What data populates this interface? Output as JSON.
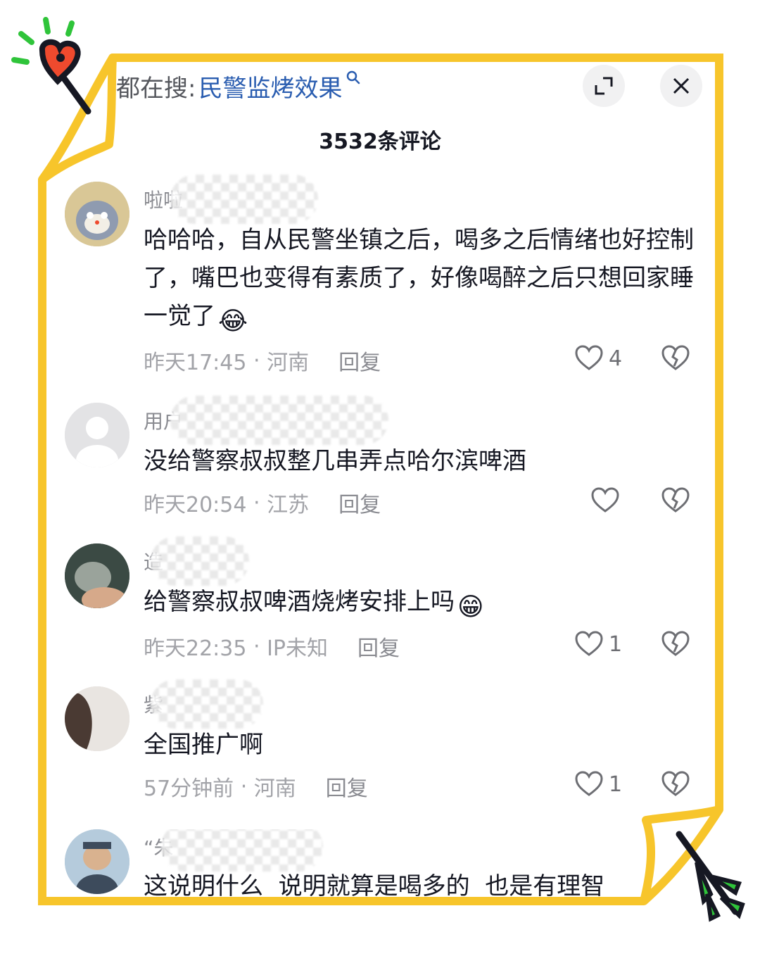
{
  "search": {
    "prefix": "都在搜:",
    "term": "民警监烤效果",
    "icon": "search-icon"
  },
  "comment_count": "3532条评论",
  "colors": {
    "frame": "#f7c52b",
    "link": "#2a5db0",
    "deco_green": "#2fc43a",
    "deco_red": "#ef4a2e"
  },
  "comments": [
    {
      "name": "啦啦",
      "text": "哈哈哈，自从民警坐镇之后，喝多之后情绪也好控制了，嘴巴也变得有素质了，好像喝醉之后只想回家睡一觉了",
      "emoji": "😂",
      "time": "昨天17:45",
      "location": "河南",
      "reply": "回复",
      "likes": "4"
    },
    {
      "name": "用户",
      "text": "没给警察叔叔整几串弄点哈尔滨啤酒",
      "emoji": "",
      "time": "昨天20:54",
      "location": "江苏",
      "reply": "回复",
      "likes": ""
    },
    {
      "name": "造",
      "text": "给警察叔叔啤酒烧烤安排上吗",
      "emoji": "😁",
      "time": "昨天22:35",
      "location": "IP未知",
      "reply": "回复",
      "likes": "1"
    },
    {
      "name": "紫",
      "text": "全国推广啊",
      "emoji": "",
      "time": "57分钟前",
      "location": "河南",
      "reply": "回复",
      "likes": "1"
    },
    {
      "name": "“朱",
      "text": "这说明什么  说明就算是喝多的  也是有理智",
      "emoji": "",
      "time": "",
      "location": "",
      "reply": "",
      "likes": ""
    }
  ]
}
